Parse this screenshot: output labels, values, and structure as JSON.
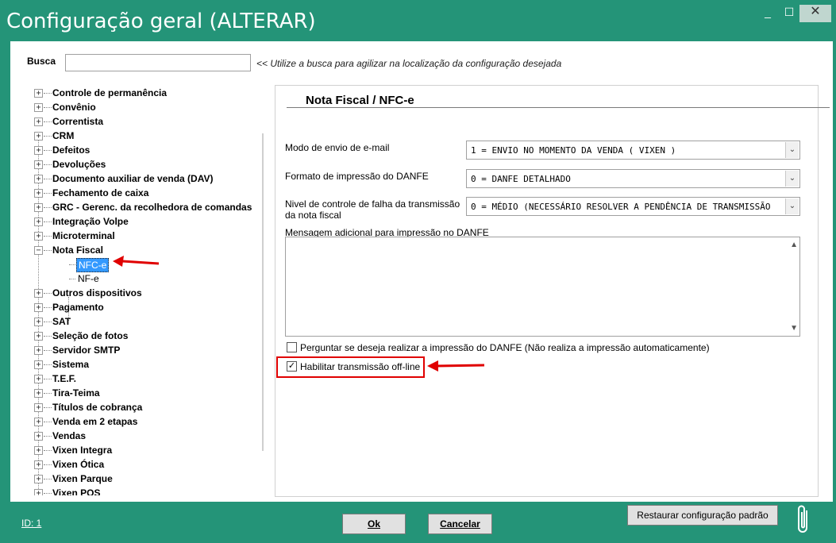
{
  "window": {
    "title": "Configuração geral (ALTERAR)",
    "minimize": "_",
    "maximize": "☐",
    "close": "✕"
  },
  "search": {
    "label": "Busca",
    "value": "",
    "hint": "<< Utilize a busca para agilizar na localização da configuração desejada"
  },
  "tree": {
    "items": [
      {
        "label": "Controle de permanência",
        "expanded": false
      },
      {
        "label": "Convênio",
        "expanded": false
      },
      {
        "label": "Correntista",
        "expanded": false
      },
      {
        "label": "CRM",
        "expanded": false
      },
      {
        "label": "Defeitos",
        "expanded": false
      },
      {
        "label": "Devoluções",
        "expanded": false
      },
      {
        "label": "Documento auxiliar de venda (DAV)",
        "expanded": false
      },
      {
        "label": "Fechamento de caixa",
        "expanded": false
      },
      {
        "label": "GRC - Gerenc. da recolhedora de comandas",
        "expanded": false
      },
      {
        "label": "Integração Volpe",
        "expanded": false
      },
      {
        "label": "Microterminal",
        "expanded": false
      },
      {
        "label": "Nota Fiscal",
        "expanded": true
      },
      {
        "label": "Outros dispositivos",
        "expanded": false
      },
      {
        "label": "Pagamento",
        "expanded": false
      },
      {
        "label": "SAT",
        "expanded": false
      },
      {
        "label": "Seleção de fotos",
        "expanded": false
      },
      {
        "label": "Servidor SMTP",
        "expanded": false
      },
      {
        "label": "Sistema",
        "expanded": false
      },
      {
        "label": "T.E.F.",
        "expanded": false
      },
      {
        "label": "Tira-Teima",
        "expanded": false
      },
      {
        "label": "Títulos de cobrança",
        "expanded": false
      },
      {
        "label": "Venda em 2 etapas",
        "expanded": false
      },
      {
        "label": "Vendas",
        "expanded": false
      },
      {
        "label": "Vixen Integra",
        "expanded": false
      },
      {
        "label": "Vixen Ótica",
        "expanded": false
      },
      {
        "label": "Vixen Parque",
        "expanded": false
      },
      {
        "label": "Vixen POS",
        "expanded": false
      }
    ],
    "nota_fiscal_children": [
      {
        "label": "NFC-e",
        "selected": true
      },
      {
        "label": "NF-e",
        "selected": false
      }
    ],
    "collapsed_glyph": "+",
    "expanded_glyph": "−"
  },
  "form": {
    "title": "Nota Fiscal / NFC-e",
    "email_mode": {
      "label": "Modo de envio de e-mail",
      "value": "1 = ENVIO NO MOMENTO DA VENDA ( VIXEN )"
    },
    "danfe_format": {
      "label": "Formato de impressão do DANFE",
      "value": "0 = DANFE DETALHADO"
    },
    "failure_control": {
      "label": "Nivel de controle de falha da transmissão da nota fiscal",
      "value": "0 = MÉDIO (NECESSÁRIO RESOLVER A PENDÊNCIA DE TRANSMISSÃO"
    },
    "extra_message": {
      "label": "Mensagem adicional para impressão no DANFE",
      "value": ""
    },
    "ask_print": {
      "label": "Perguntar se deseja realizar a impressão do DANFE (Não realiza a impressão automaticamente)",
      "checked": false
    },
    "offline": {
      "label": "Habilitar transmissão off-line",
      "checked": true
    },
    "dropdown_glyph": "⌄"
  },
  "footer": {
    "id_label": "ID: 1",
    "ok": "Ok",
    "cancel": "Cancelar",
    "restore": "Restaurar configuração padrão"
  },
  "colors": {
    "window_bg": "#249478",
    "selection": "#3399ff",
    "annotation": "#e00000"
  }
}
